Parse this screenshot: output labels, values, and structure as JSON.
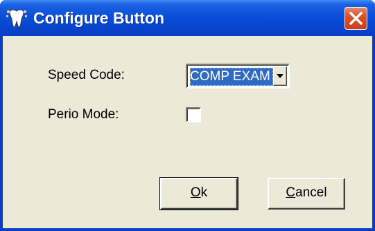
{
  "window": {
    "title": "Configure Button",
    "app_icon": "tooth-icon",
    "close_icon": "close-icon"
  },
  "form": {
    "speed_code_label": "Speed Code:",
    "speed_code_value": "COMP EXAM",
    "perio_mode_label": "Perio Mode:",
    "perio_mode_checked": false
  },
  "buttons": {
    "ok": {
      "mnemonic": "O",
      "rest": "k"
    },
    "cancel": {
      "mnemonic": "C",
      "rest": "ancel"
    }
  },
  "colors": {
    "titlebar": "#0a4fd8",
    "dialog_face": "#ece9d8",
    "selection": "#316ac5",
    "close_button": "#d9532d"
  }
}
